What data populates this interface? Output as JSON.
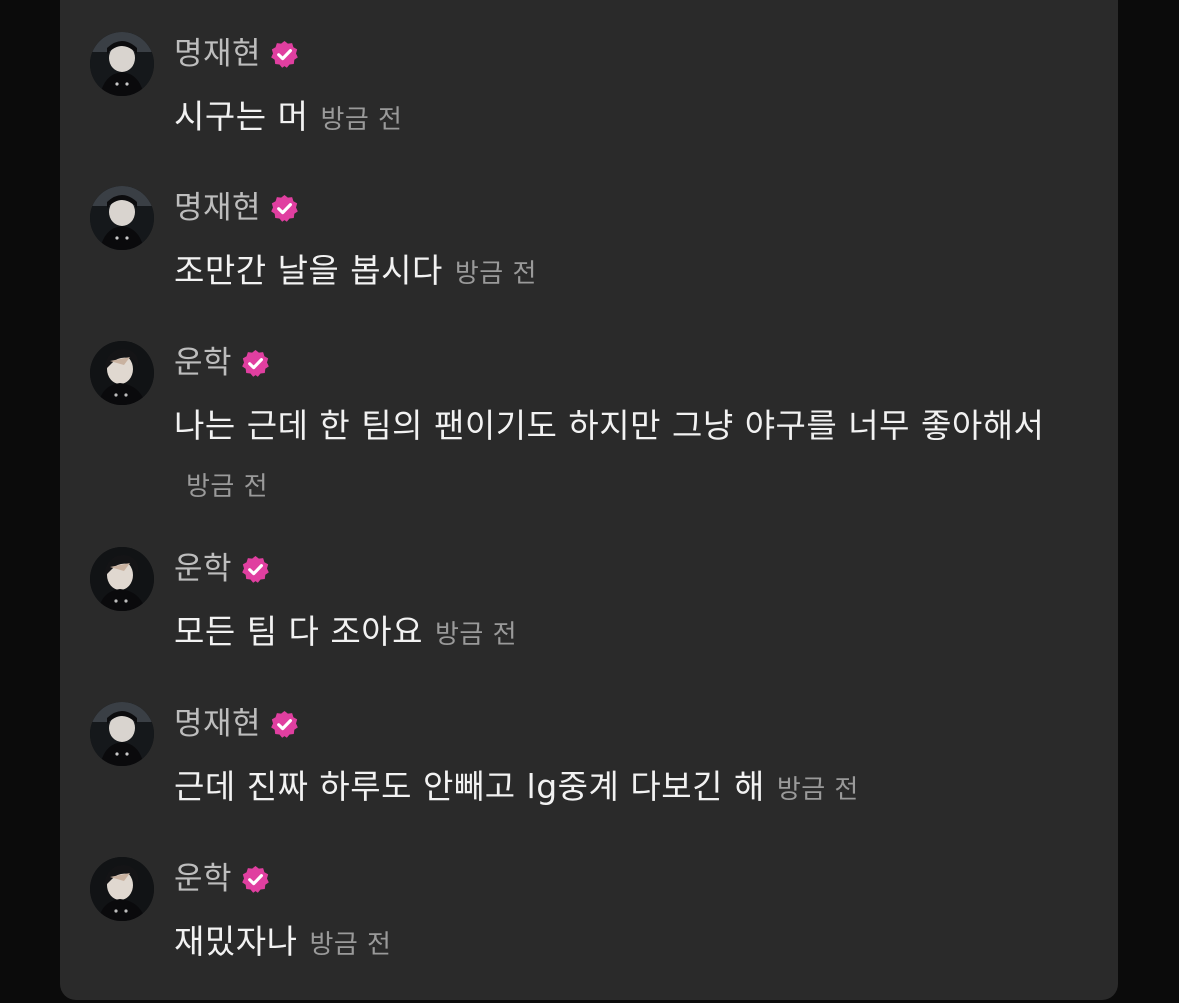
{
  "accent_badge_color": "#e03fa0",
  "badge_icon": "verified-check-badge",
  "messages": [
    {
      "author": "명재현",
      "text": "시구는 머",
      "time": "방금 전"
    },
    {
      "author": "명재현",
      "text": "조만간 날을 봅시다",
      "time": "방금 전"
    },
    {
      "author": "운학",
      "text": "나는 근데 한 팀의 팬이기도 하지만 그냥 야구를 너무 좋아해서",
      "time": "방금 전"
    },
    {
      "author": "운학",
      "text": "모든 팀 다 조아요",
      "time": "방금 전"
    },
    {
      "author": "명재현",
      "text": "근데 진짜 하루도 안빼고 lg중계 다보긴 해",
      "time": "방금 전"
    },
    {
      "author": "운학",
      "text": "재밌자나",
      "time": "방금 전"
    }
  ]
}
